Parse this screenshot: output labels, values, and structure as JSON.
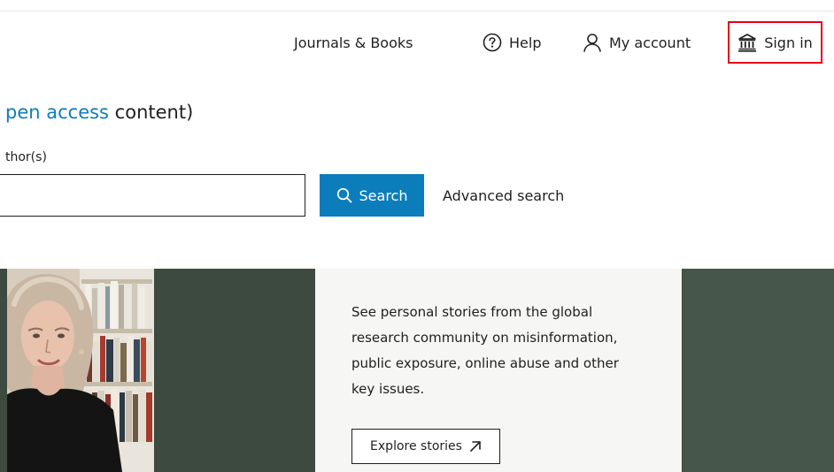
{
  "nav": {
    "journals_label": "Journals & Books",
    "help_label": "Help",
    "account_label": "My account",
    "signin_label": "Sign in"
  },
  "hero": {
    "heading_accent": "pen access",
    "heading_rest": " content)",
    "field_label": "thor(s)",
    "search_value": "",
    "search_button_label": "Search",
    "advanced_search_label": "Advanced search"
  },
  "banner": {
    "promo_text": "See personal stories from the global research community on misinformation, public exposure, online abuse and other key issues.",
    "cta_label": "Explore stories"
  },
  "icons": {
    "help": "help-circle-icon",
    "account": "user-icon",
    "signin": "institution-icon",
    "search": "search-icon",
    "cta": "arrow-up-right-icon"
  },
  "colors": {
    "accent": "#0c7dbb",
    "highlight_border": "#e4001b",
    "banner_dark": "#3d4a40"
  }
}
